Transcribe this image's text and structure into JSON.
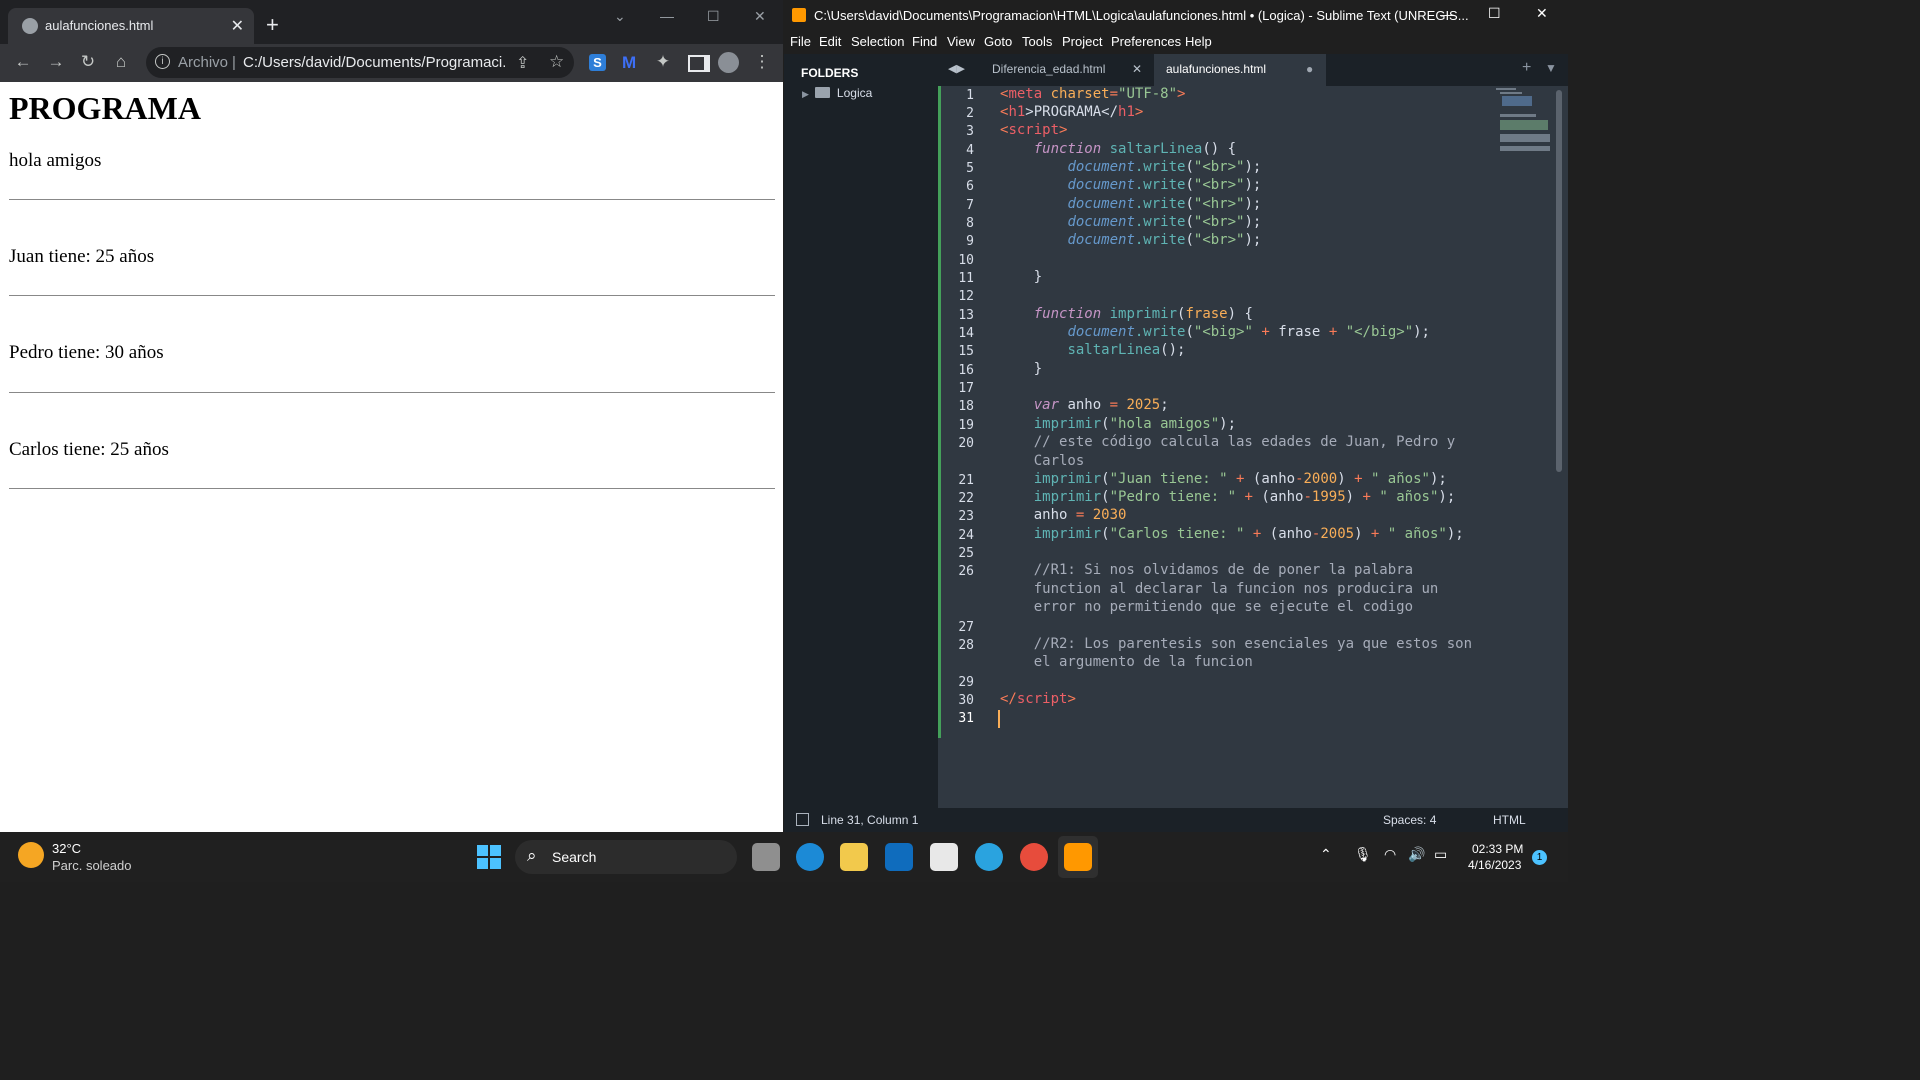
{
  "chrome": {
    "tab_title": "aulafunciones.html",
    "omnibox_label": "Archivo",
    "url": "C:/Users/david/Documents/Programaci..."
  },
  "page": {
    "heading": "PROGRAMA",
    "lines": [
      "hola amigos",
      "Juan tiene: 25 años",
      "Pedro tiene: 30 años",
      "Carlos tiene: 25 años"
    ]
  },
  "sublime": {
    "window_title": "C:\\Users\\david\\Documents\\Programacion\\HTML\\Logica\\aulafunciones.html • (Logica) - Sublime Text (UNREGIS...",
    "menu": [
      "File",
      "Edit",
      "Selection",
      "Find",
      "View",
      "Goto",
      "Tools",
      "Project",
      "Preferences",
      "Help"
    ],
    "sidebar_header": "FOLDERS",
    "folder": "Logica",
    "tabs": [
      "Diferencia_edad.html",
      "aulafunciones.html"
    ],
    "line_numbers": [
      "1",
      "2",
      "3",
      "4",
      "5",
      "6",
      "7",
      "8",
      "9",
      "10",
      "11",
      "12",
      "13",
      "14",
      "15",
      "16",
      "17",
      "18",
      "19",
      "20",
      "21",
      "22",
      "23",
      "24",
      "25",
      "26",
      "27",
      "28",
      "29",
      "30",
      "31"
    ],
    "code": {
      "l1a": "<",
      "l1b": "meta",
      "l1c": " charset",
      "l1d": "=",
      "l1e": "\"UTF-8\"",
      "l1f": ">",
      "l2a": "<",
      "l2b": "h1",
      "l2c": ">PROGRAMA</",
      "l2d": "h1",
      "l2e": ">",
      "l3a": "<",
      "l3b": "script",
      "l3c": ">",
      "fn": "function",
      "saltarLinea": "saltarLinea",
      "document": "document",
      "write": ".write",
      "br": "\"<br>\"",
      "hr": "\"<hr>\"",
      "imprimir": "imprimir",
      "frase": "frase",
      "big_open": "\"<big>\"",
      "big_close": "\"</big>\"",
      "var": "var",
      "anho": "anho",
      "y2025": "2025",
      "hola": "\"hola amigos\"",
      "c20a": "// este código calcula las edades de Juan, Pedro y",
      "c20b": "Carlos",
      "juan": "\"Juan tiene: \"",
      "pedro": "\"Pedro tiene: \"",
      "carlos": "\"Carlos tiene: \"",
      "y2000": "2000",
      "y1995": "1995",
      "y2030": "2030",
      "y2005": "2005",
      "anos": "\" años\"",
      "r1a": "//R1: Si nos olvidamos de de poner la palabra",
      "r1b": "function al declarar la funcion nos producira un",
      "r1c": "error no permitiendo que se ejecute el codigo",
      "r2a": "//R2: Los parentesis son esenciales ya que estos son",
      "r2b": "el argumento de la funcion",
      "endscript": "script"
    },
    "status": {
      "position": "Line 31, Column 1",
      "spaces": "Spaces: 4",
      "syntax": "HTML"
    }
  },
  "taskbar": {
    "weather_temp": "32°C",
    "weather_desc": "Parc. soleado",
    "search": "Search",
    "time": "02:33 PM",
    "date": "4/16/2023",
    "notifications": "1"
  }
}
